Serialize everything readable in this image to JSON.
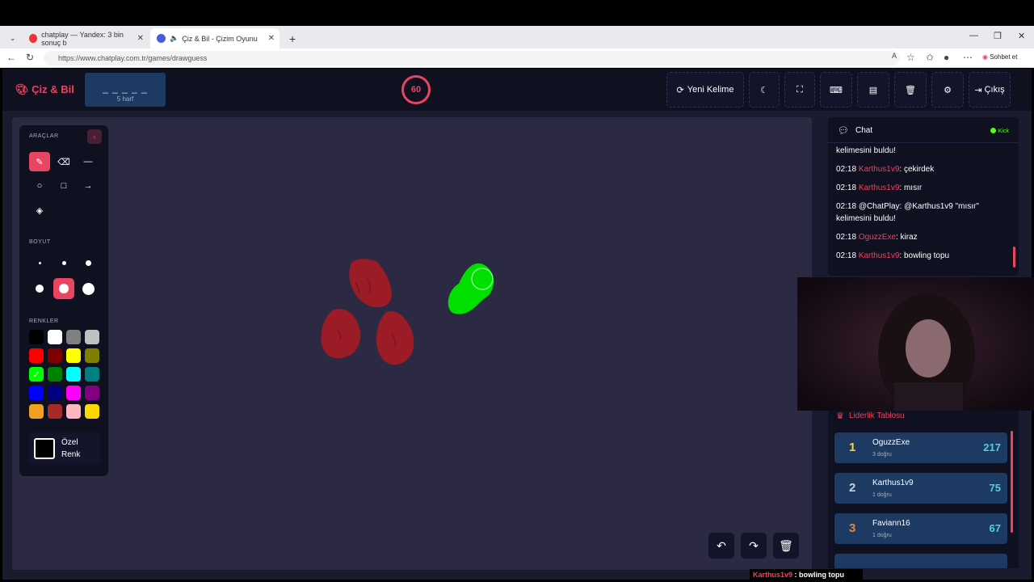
{
  "browser": {
    "tabs": [
      {
        "title": "chatplay — Yandex: 3 bin sonuç b",
        "active": false
      },
      {
        "title": "Çiz & Bil - Çizim Oyunu",
        "active": true
      }
    ],
    "url": "https://www.chatplay.com.tr/games/drawguess",
    "copilot_label": "Sohbet et"
  },
  "header": {
    "logo": "Çiz & Bil",
    "word_mask": "_ _ _ _ _",
    "word_hint": "5 harf",
    "timer": "60",
    "new_word_label": "Yeni Kelime",
    "exit_label": "Çıkış"
  },
  "tools": {
    "section_tools": "ARAÇLAR",
    "section_size": "BOYUT",
    "section_colors": "RENKLER",
    "custom_color_line1": "Özel",
    "custom_color_line2": "Renk",
    "colors": [
      "#000000",
      "#ffffff",
      "#808080",
      "#c0c0c0",
      "#ff0000",
      "#800000",
      "#ffff00",
      "#808000",
      "#00ff00",
      "#008000",
      "#00ffff",
      "#008080",
      "#0000ff",
      "#000080",
      "#ff00ff",
      "#800080",
      "#f0a020",
      "#a52a2a",
      "#ffb6c1",
      "#ffd700"
    ]
  },
  "chat": {
    "title": "Chat",
    "platform": "Kick",
    "messages": [
      {
        "time": "",
        "user": "",
        "text": "kelimesini buldu!"
      },
      {
        "time": "02:18",
        "user": "Karthus1v9",
        "text": ": çekirdek"
      },
      {
        "time": "02:18",
        "user": "Karthus1v9",
        "text": ": mısır"
      },
      {
        "time": "02:18",
        "user": "",
        "text": "@ChatPlay: @Karthus1v9 \"mısır\" kelimesini buldu!"
      },
      {
        "time": "02:18",
        "user": "OguzzExe",
        "text": ": kiraz"
      },
      {
        "time": "02:18",
        "user": "Karthus1v9",
        "text": ": bowling topu"
      }
    ]
  },
  "leaderboard": {
    "title": "Liderlik Tablosu",
    "rows": [
      {
        "rank": "1",
        "name": "OguzzExe",
        "sub": "3 doğru",
        "score": "217",
        "color": "#f5d742"
      },
      {
        "rank": "2",
        "name": "Karthus1v9",
        "sub": "1 doğru",
        "score": "75",
        "color": "#c8d0dc"
      },
      {
        "rank": "3",
        "name": "Faviann16",
        "sub": "1 doğru",
        "score": "67",
        "color": "#e08a3c"
      }
    ]
  },
  "overlay": {
    "user": "Karthus1v9",
    "text": " : bowling topu"
  }
}
